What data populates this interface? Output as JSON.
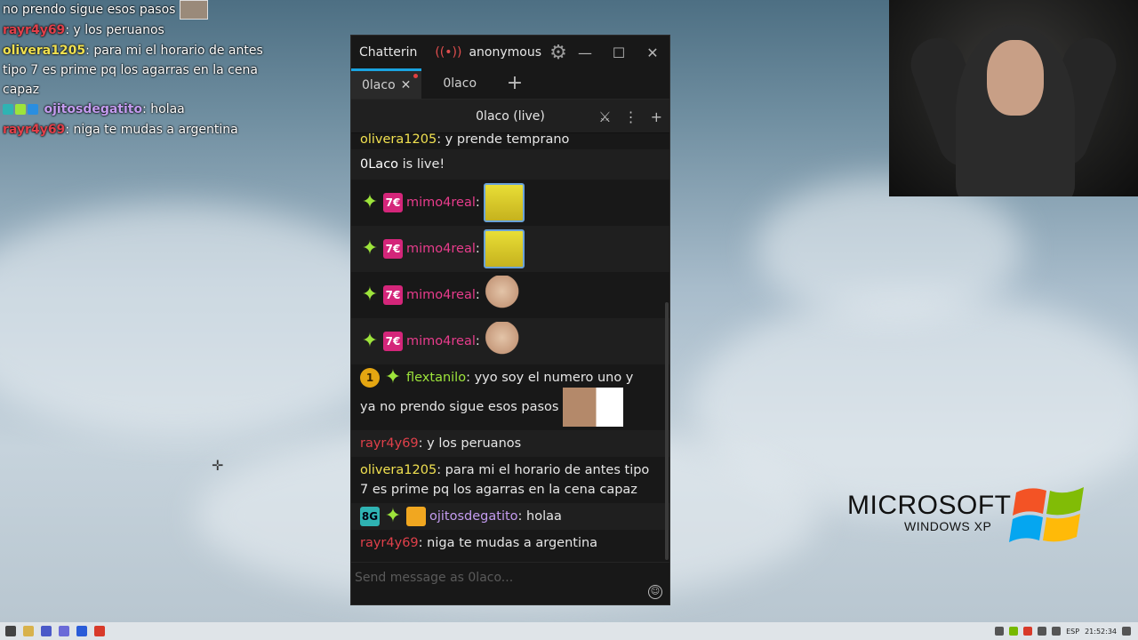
{
  "overlay_chat": [
    {
      "user": "",
      "text": "no prendo sigue esos pasos",
      "user_color": "#ffffff",
      "emote": true
    },
    {
      "user": "rayr4y69",
      "text": ": y los peruanos",
      "user_color": "#e0404a"
    },
    {
      "user": "olivera1205",
      "text": ": para mi el horario de antes tipo 7 es prime pq los agarras en la cena capaz",
      "user_color": "#f0e050"
    },
    {
      "user": "ojitosdegatito",
      "text": ": holaa",
      "user_color": "#c49cf0"
    },
    {
      "user": "rayr4y69",
      "text": ": niga te mudas a argentina",
      "user_color": "#e0404a"
    }
  ],
  "window": {
    "app_name": "Chatterin",
    "account": "anonymous",
    "minimize": "—",
    "maximize": "☐",
    "close": "✕"
  },
  "tabs": [
    {
      "label": "0laco",
      "active": true
    },
    {
      "label": "0laco",
      "active": false
    }
  ],
  "tab_add": "+",
  "split": {
    "title": "0laco (live)",
    "menu": "⋮",
    "add": "+"
  },
  "messages": [
    {
      "user": "olivera1205",
      "text": ": y prende temprano",
      "user_color": "#f0e050"
    },
    {
      "system": "0Laco",
      "text": " is live!"
    },
    {
      "user": "mimo4real",
      "text": ":",
      "emote": "sponge"
    },
    {
      "user": "mimo4real",
      "text": ":",
      "emote": "sponge"
    },
    {
      "user": "mimo4real",
      "text": ":",
      "emote": "hamster"
    },
    {
      "user": "mimo4real",
      "text": ":",
      "emote": "hamster"
    },
    {
      "user": "flextanilo",
      "text": ": yyo soy el numero uno y",
      "text2": "ya no prendo sigue esos pasos",
      "user_color": "#9de43b",
      "emote": "bro"
    },
    {
      "user": "rayr4y69",
      "text": ": y los peruanos",
      "user_color": "#e0404a"
    },
    {
      "user": "olivera1205",
      "text": ": para mi el horario de antes tipo 7 es prime pq los agarras en la cena capaz",
      "user_color": "#f0e050"
    },
    {
      "user": "ojitosdegatito",
      "text": ": holaa",
      "user_color": "#c49cf0"
    },
    {
      "user": "rayr4y69",
      "text": ": niga te mudas a argentina",
      "user_color": "#e0404a"
    }
  ],
  "input": {
    "placeholder": "Send message as 0laco..."
  },
  "desktop": {
    "brand": "MICROSOFT",
    "product": "WINDOWS XP"
  },
  "taskbar": {
    "lang": "ESP",
    "time": "21:52:34"
  }
}
